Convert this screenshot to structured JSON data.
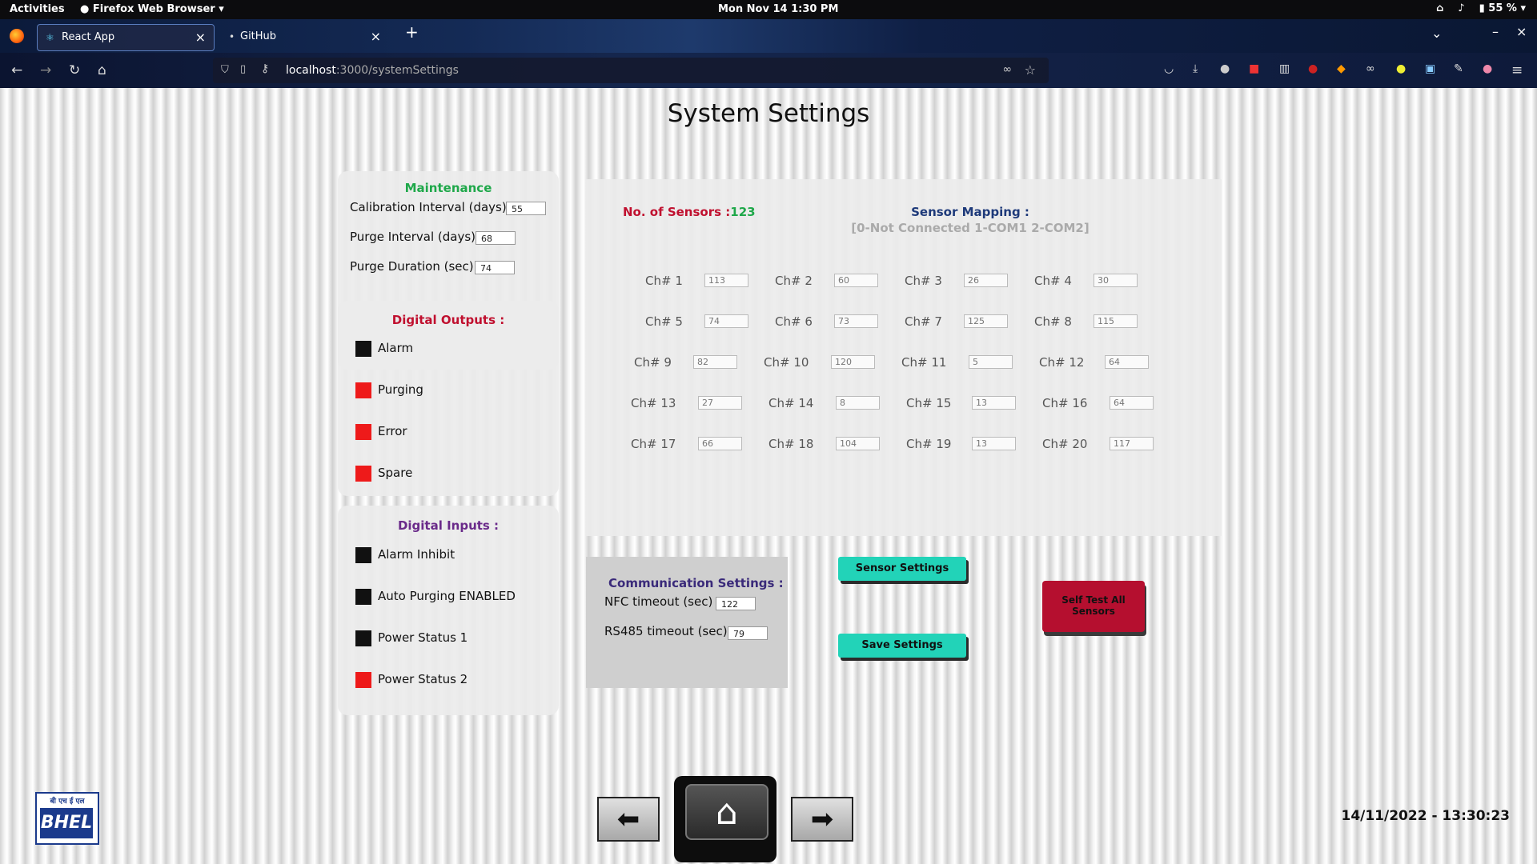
{
  "os": {
    "activities": "Activities",
    "app_name": "Firefox Web Browser",
    "clock": "Mon Nov 14  1:30 PM",
    "battery": "55 %"
  },
  "browser": {
    "tabs": [
      {
        "label": "React App"
      },
      {
        "label": "GitHub"
      }
    ],
    "url_host": "localhost",
    "url_rest": ":3000/systemSettings"
  },
  "page": {
    "title": "System Settings",
    "maintenance": {
      "heading": "Maintenance",
      "calibration_label": "Calibration Interval (days)",
      "calibration_value": "55",
      "purge_interval_label": "Purge Interval (days)",
      "purge_interval_value": "68",
      "purge_duration_label": "Purge Duration (sec)",
      "purge_duration_value": "74"
    },
    "digital_outputs": {
      "heading": "Digital Outputs :",
      "items": [
        {
          "label": "Alarm",
          "state_color": "#111111"
        },
        {
          "label": "Purging",
          "state_color": "#ee1a1a"
        },
        {
          "label": "Error",
          "state_color": "#ee1a1a"
        },
        {
          "label": "Spare",
          "state_color": "#ee1a1a"
        }
      ]
    },
    "digital_inputs": {
      "heading": "Digital Inputs :",
      "items": [
        {
          "label": "Alarm Inhibit",
          "state_color": "#111111"
        },
        {
          "label": "Auto Purging ENABLED",
          "state_color": "#111111"
        },
        {
          "label": "Power Status 1",
          "state_color": "#111111"
        },
        {
          "label": "Power Status 2",
          "state_color": "#ee1a1a"
        }
      ]
    },
    "sensors": {
      "count_label": "No. of Sensors :",
      "count_value": "123",
      "mapping_title": "Sensor Mapping :",
      "mapping_legend": "[0-Not Connected 1-COM1 2-COM2]",
      "channels": [
        {
          "label": "Ch# 1",
          "value": "113"
        },
        {
          "label": "Ch# 2",
          "value": "60"
        },
        {
          "label": "Ch# 3",
          "value": "26"
        },
        {
          "label": "Ch# 4",
          "value": "30"
        },
        {
          "label": "Ch# 5",
          "value": "74"
        },
        {
          "label": "Ch# 6",
          "value": "73"
        },
        {
          "label": "Ch# 7",
          "value": "125"
        },
        {
          "label": "Ch# 8",
          "value": "115"
        },
        {
          "label": "Ch# 9",
          "value": "82"
        },
        {
          "label": "Ch# 10",
          "value": "120"
        },
        {
          "label": "Ch# 11",
          "value": "5"
        },
        {
          "label": "Ch# 12",
          "value": "64"
        },
        {
          "label": "Ch# 13",
          "value": "27"
        },
        {
          "label": "Ch# 14",
          "value": "8"
        },
        {
          "label": "Ch# 15",
          "value": "13"
        },
        {
          "label": "Ch# 16",
          "value": "64"
        },
        {
          "label": "Ch# 17",
          "value": "66"
        },
        {
          "label": "Ch# 18",
          "value": "104"
        },
        {
          "label": "Ch# 19",
          "value": "13"
        },
        {
          "label": "Ch# 20",
          "value": "117"
        }
      ]
    },
    "communication": {
      "heading": "Communication Settings :",
      "nfc_label": "NFC timeout (sec)",
      "nfc_value": "122",
      "rs485_label": "RS485 timeout (sec)",
      "rs485_value": "79"
    },
    "buttons": {
      "sensor_settings": "Sensor Settings",
      "save_settings": "Save Settings",
      "self_test_line1": "Self Test All",
      "self_test_line2": "Sensors"
    },
    "datetime": "14/11/2022 - 13:30:23",
    "logo": {
      "top": "बी एच ई एल",
      "main": "BHEL"
    },
    "colors": {
      "maintenance_heading": "#1fa84a",
      "outputs_heading": "#c0102f",
      "inputs_heading": "#6a2a8a",
      "sensor_count_label": "#c0102f",
      "sensor_count_value": "#1fa84a",
      "mapping_title": "#1e3a7a",
      "comm_heading": "#3a2a7a",
      "button_teal": "#22d3b8",
      "button_red": "#b50f2f"
    }
  }
}
